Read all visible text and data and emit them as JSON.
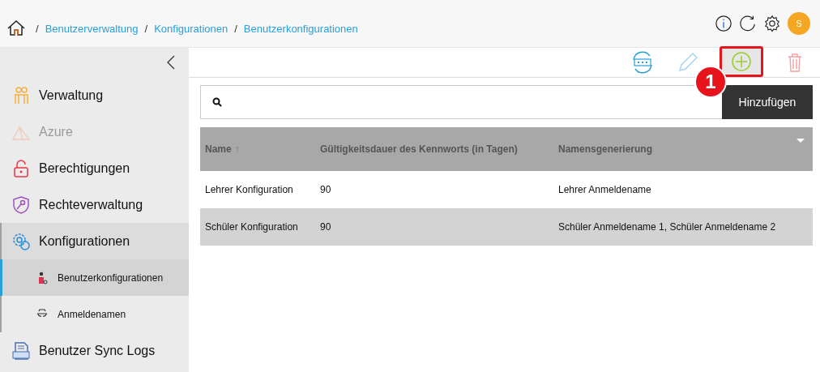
{
  "breadcrumb": [
    {
      "separator": "/",
      "label": "Benutzerverwaltung"
    },
    {
      "separator": "/",
      "label": "Konfigurationen"
    },
    {
      "separator": "/",
      "label": "Benutzerkonfigurationen"
    }
  ],
  "header": {
    "avatar": "S"
  },
  "sidebar": {
    "items": [
      {
        "label": "Verwaltung",
        "disabled": false,
        "expanded": false
      },
      {
        "label": "Azure",
        "disabled": true,
        "expanded": false
      },
      {
        "label": "Berechtigungen",
        "disabled": false,
        "expanded": false
      },
      {
        "label": "Rechteverwaltung",
        "disabled": false,
        "expanded": false
      },
      {
        "label": "Konfigurationen",
        "disabled": false,
        "expanded": true,
        "children": [
          {
            "label": "Benutzerkonfigurationen",
            "selected": true
          },
          {
            "label": "Anmeldenamen",
            "selected": false
          }
        ]
      },
      {
        "label": "Benutzer Sync Logs",
        "disabled": false,
        "expanded": false
      }
    ]
  },
  "toolbar": [
    {
      "kind": "password",
      "disabled": false,
      "highlighted": false
    },
    {
      "kind": "edit",
      "disabled": true,
      "highlighted": false
    },
    {
      "kind": "add",
      "disabled": false,
      "highlighted": true
    },
    {
      "kind": "delete",
      "disabled": true,
      "highlighted": false
    }
  ],
  "annotation_badge": "1",
  "tooltip": "Hinzufügen",
  "table": {
    "columns": [
      {
        "label": "Name",
        "sort_indicator": "↑"
      },
      {
        "label": "Gültigkeitsdauer des Kennworts (in Tagen)"
      },
      {
        "label": "Namensgenerierung"
      }
    ],
    "rows": [
      {
        "cells": [
          "Lehrer Konfiguration",
          "90",
          "Lehrer Anmeldename"
        ],
        "selected": false
      },
      {
        "cells": [
          "Schüler Konfiguration",
          "90",
          "Schüler Anmeldename 1, Schüler Anmeldename 2"
        ],
        "selected": true
      }
    ]
  }
}
